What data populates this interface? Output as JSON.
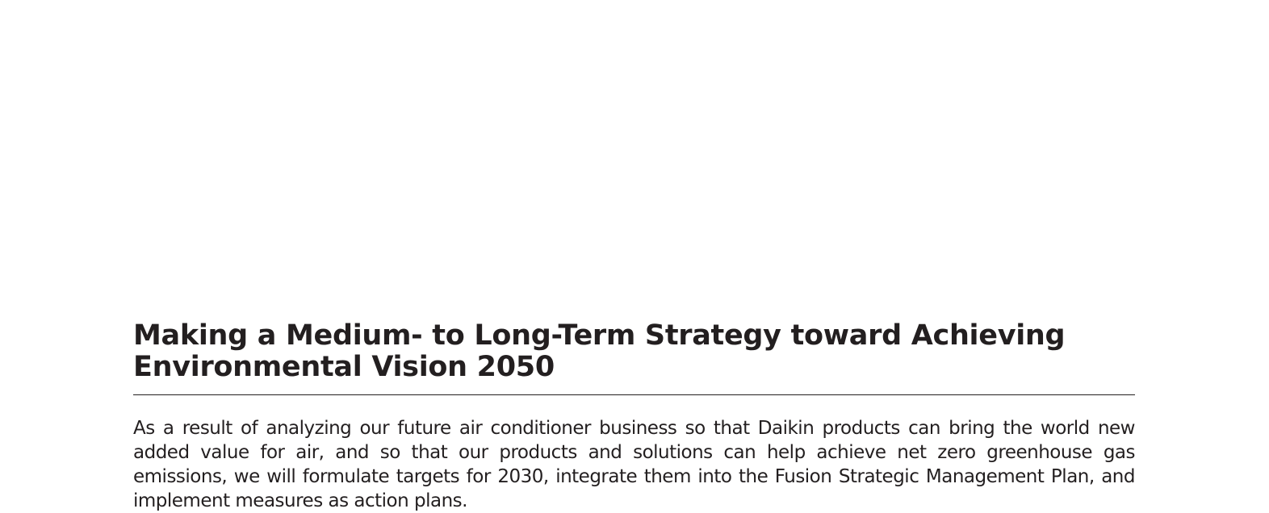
{
  "section": {
    "title_line1": "Making a Medium- to Long-Term Strategy toward Achieving",
    "title_line2": "Environmental Vision 2050",
    "body": "As a result of analyzing our future air conditioner business so that Daikin products can bring the world new added value for air, and so that our products and solutions can help achieve net zero greenhouse gas emissions, we will formulate targets for 2030, integrate them into the Fusion Strategic Management Plan, and implement measures as action plans."
  }
}
